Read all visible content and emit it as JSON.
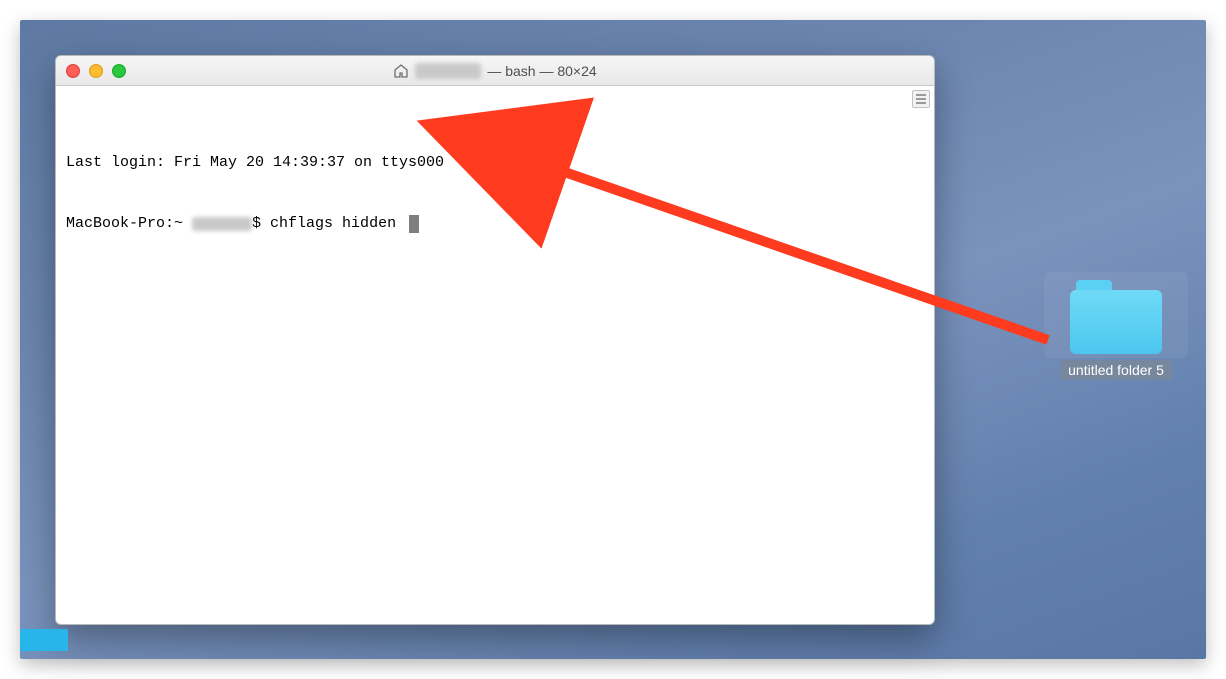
{
  "terminal": {
    "window_title_suffix": " — bash — 80×24",
    "last_login": "Last login: Fri May 20 14:39:37 on ttys000",
    "prompt_prefix": "MacBook-Pro:~ ",
    "prompt_suffix": "$ ",
    "command": "chflags hidden "
  },
  "desktop_folder": {
    "label": "untitled folder 5"
  },
  "annotation": {
    "arrow_color": "#ff3b1f"
  }
}
